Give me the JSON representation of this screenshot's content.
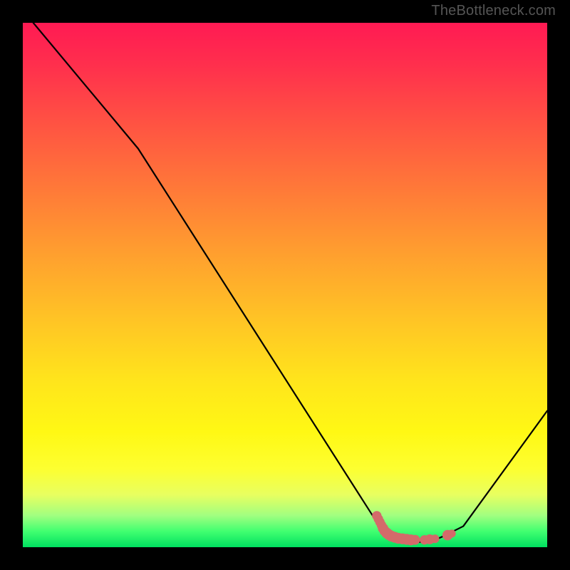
{
  "watermark": "TheBottleneck.com",
  "chart_data": {
    "type": "line",
    "title": "",
    "xlabel": "",
    "ylabel": "",
    "xlim": [
      0,
      100
    ],
    "ylim": [
      0,
      100
    ],
    "series": [
      {
        "name": "curve",
        "color": "#000000",
        "x": [
          2,
          22,
          68,
          71,
          77,
          80,
          84,
          100
        ],
        "y": [
          100,
          76,
          4,
          2,
          1,
          2,
          4,
          26
        ]
      }
    ],
    "scatter": {
      "name": "highlight-points",
      "color": "#d36a6a",
      "points": [
        {
          "x": 67.5,
          "y": 6.0,
          "r": 2.0
        },
        {
          "x": 67.8,
          "y": 5.4,
          "r": 2.0
        },
        {
          "x": 68.1,
          "y": 4.8,
          "r": 2.0
        },
        {
          "x": 68.4,
          "y": 4.2,
          "r": 2.0
        },
        {
          "x": 68.7,
          "y": 3.6,
          "r": 2.2
        },
        {
          "x": 69.0,
          "y": 3.1,
          "r": 2.2
        },
        {
          "x": 69.4,
          "y": 2.7,
          "r": 2.3
        },
        {
          "x": 69.8,
          "y": 2.4,
          "r": 2.3
        },
        {
          "x": 70.3,
          "y": 2.1,
          "r": 2.3
        },
        {
          "x": 70.9,
          "y": 1.9,
          "r": 2.3
        },
        {
          "x": 71.6,
          "y": 1.7,
          "r": 2.3
        },
        {
          "x": 72.4,
          "y": 1.6,
          "r": 2.3
        },
        {
          "x": 73.2,
          "y": 1.5,
          "r": 2.3
        },
        {
          "x": 74.0,
          "y": 1.4,
          "r": 2.3
        },
        {
          "x": 74.8,
          "y": 1.4,
          "r": 2.1
        },
        {
          "x": 76.6,
          "y": 1.4,
          "r": 2.0
        },
        {
          "x": 77.6,
          "y": 1.5,
          "r": 2.1
        },
        {
          "x": 78.6,
          "y": 1.6,
          "r": 1.8
        },
        {
          "x": 81.0,
          "y": 2.3,
          "r": 2.2
        },
        {
          "x": 81.8,
          "y": 2.6,
          "r": 1.7
        }
      ]
    },
    "gradient": {
      "top": "#ff1a53",
      "bottom": "#00e060"
    }
  }
}
